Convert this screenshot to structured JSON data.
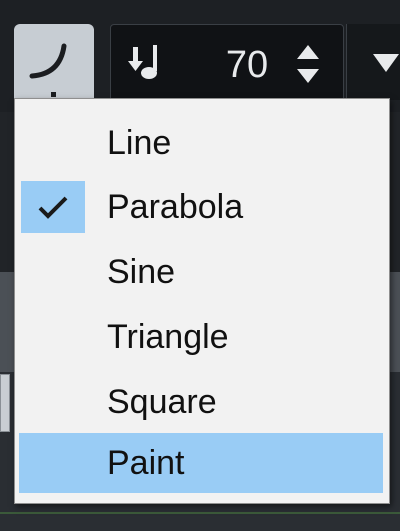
{
  "toolbar": {
    "velocity_value": "70",
    "icons": [
      "curve-icon",
      "note-velocity-icon",
      "stepper-up-icon",
      "stepper-down-icon",
      "dropdown-triangle-icon"
    ]
  },
  "menu": {
    "items": [
      {
        "label": "Line",
        "checked": false,
        "highlighted": false
      },
      {
        "label": "Parabola",
        "checked": true,
        "highlighted": false
      },
      {
        "label": "Sine",
        "checked": false,
        "highlighted": false
      },
      {
        "label": "Triangle",
        "checked": false,
        "highlighted": false
      },
      {
        "label": "Square",
        "checked": false,
        "highlighted": false
      },
      {
        "label": "Paint",
        "checked": false,
        "highlighted": true
      }
    ]
  },
  "colors": {
    "highlight": "#99ccf5",
    "menu_background": "#f2f2f2",
    "toolbar_background": "#1d2024"
  }
}
